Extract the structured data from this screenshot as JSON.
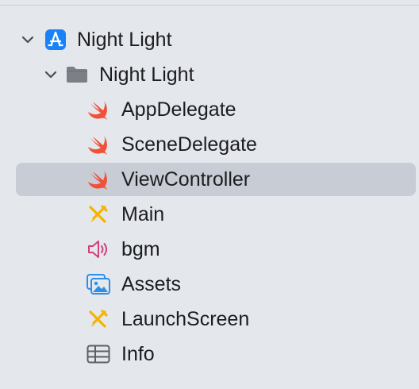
{
  "navigator": {
    "project": {
      "label": "Night Light",
      "icon": "xcode-app-project-icon",
      "expanded": true,
      "accent": "#1a82f7"
    },
    "group": {
      "label": "Night Light",
      "icon": "folder-icon",
      "expanded": true,
      "color": "#7d7f86"
    },
    "items": [
      {
        "label": "AppDelegate",
        "icon": "swift-icon",
        "selected": false
      },
      {
        "label": "SceneDelegate",
        "icon": "swift-icon",
        "selected": false
      },
      {
        "label": "ViewController",
        "icon": "swift-icon",
        "selected": true
      },
      {
        "label": "Main",
        "icon": "storyboard-icon",
        "selected": false
      },
      {
        "label": "bgm",
        "icon": "audio-speaker-icon",
        "selected": false
      },
      {
        "label": "Assets",
        "icon": "asset-catalog-icon",
        "selected": false
      },
      {
        "label": "LaunchScreen",
        "icon": "storyboard-icon",
        "selected": false
      },
      {
        "label": "Info",
        "icon": "plist-table-icon",
        "selected": false
      }
    ],
    "colors": {
      "swift": "#f05138",
      "storyboard": "#f6b300",
      "audio": "#d1407b",
      "assets": "#2f8fe8",
      "plist": "#5b5f66",
      "selection": "#c7ccd5",
      "background": "#e4e7ec"
    }
  }
}
